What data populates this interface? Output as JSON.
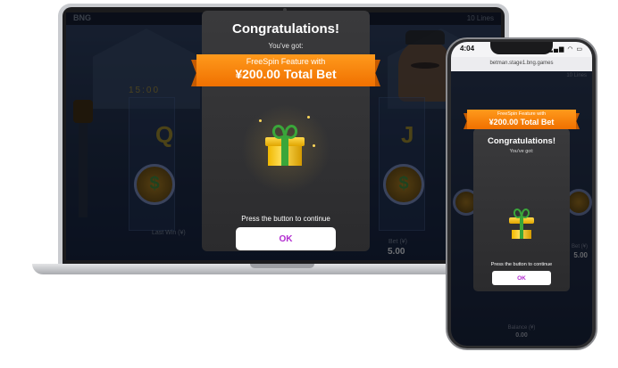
{
  "laptop": {
    "brand": "BNG",
    "lines": "10 Lines",
    "counter": "15:00",
    "symbols": {
      "q": "Q",
      "j": "J",
      "coin": "$"
    },
    "last_win_label": "Last Win (¥)",
    "bet_label": "Bet (¥)",
    "bet_value": "5.00"
  },
  "popup": {
    "title": "Congratulations!",
    "subtitle": "You've got:",
    "ribbon_line1": "FreeSpin Feature with",
    "ribbon_line2": "¥200.00 Total Bet",
    "hint": "Press the button to continue",
    "ok_label": "OK",
    "ok_color": "#b22bd0",
    "ribbon_color": "#f58a0c",
    "gift_icon": "gift-box-icon"
  },
  "phone": {
    "time": "4:04",
    "signal": "▂▄▆ ◠ ▭",
    "url": "betman.stage1.bng.games",
    "lines": "10 Lines",
    "title": "Congratulations!",
    "subtitle": "You've got:",
    "ribbon_line1": "FreeSpin Feature with",
    "ribbon_line2": "¥200.00 Total Bet",
    "hint": "Press the button to continue",
    "ok_label": "OK",
    "bet_label": "Bet (¥)",
    "bet_value": "5.00",
    "balance_label": "Balance (¥)",
    "balance_value": "0.00"
  }
}
